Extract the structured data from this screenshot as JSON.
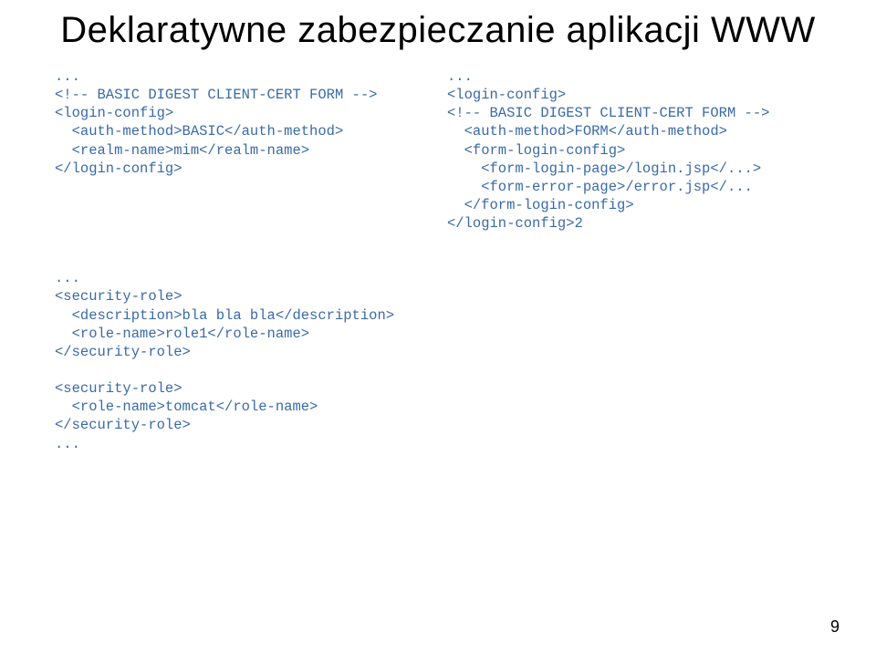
{
  "title": "Deklaratywne zabezpieczanie aplikacji WWW",
  "left_code": "...\n<!-- BASIC DIGEST CLIENT-CERT FORM -->\n<login-config>\n  <auth-method>BASIC</auth-method>\n  <realm-name>mim</realm-name>\n</login-config>",
  "right_code": "...\n<login-config>\n<!-- BASIC DIGEST CLIENT-CERT FORM -->\n  <auth-method>FORM</auth-method>\n  <form-login-config>\n    <form-login-page>/login.jsp</...>\n    <form-error-page>/error.jsp</...\n  </form-login-config>\n</login-config>2",
  "bottom_code": "...\n<security-role>\n  <description>bla bla bla</description>\n  <role-name>role1</role-name>\n</security-role>\n\n<security-role>\n  <role-name>tomcat</role-name>\n</security-role>\n...",
  "page_number": "9"
}
